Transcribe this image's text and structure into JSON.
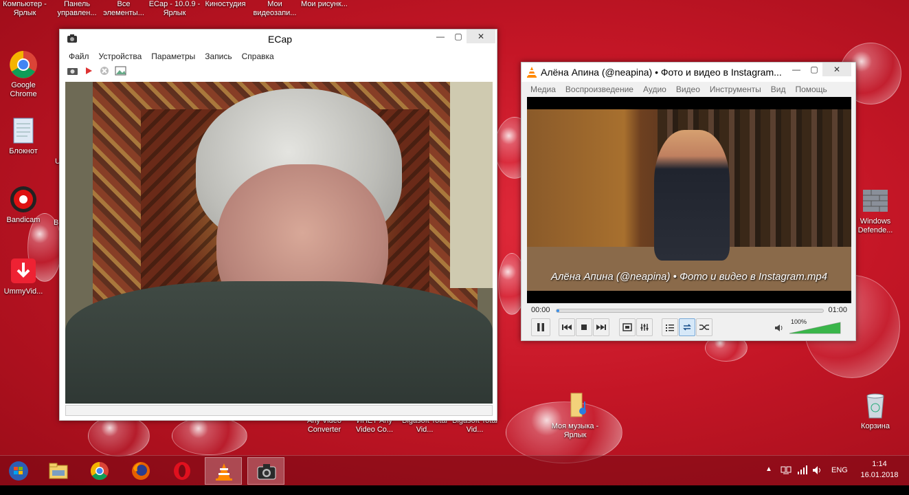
{
  "desktop": {
    "top_icons": [
      {
        "label": "Компьютер - Ярлык"
      },
      {
        "label": "Панель управлен..."
      },
      {
        "label": "Все элементы..."
      },
      {
        "label": "ECap - 10.0.9 - Ярлык"
      },
      {
        "label": "Киностудия"
      },
      {
        "label": "Мои видеозапи..."
      },
      {
        "label": "Мои рисунк..."
      }
    ],
    "left_icons": [
      {
        "label": "Google Chrome"
      },
      {
        "label": "Блокнот"
      },
      {
        "label": "Bandicam"
      },
      {
        "label": "UmmyVid..."
      }
    ],
    "left_partial": [
      "U",
      "B"
    ],
    "bottom_icons": [
      {
        "label": "Any Video Converter"
      },
      {
        "label": "ИНЕТ Any Video Co..."
      },
      {
        "label": "Bigasoft Total Vid..."
      },
      {
        "label": "Bigasoft Total Vid..."
      },
      {
        "label": "Моя музыка - Ярлык"
      }
    ],
    "right_icons": [
      {
        "label": "Windows Defende..."
      },
      {
        "label": "Корзина"
      }
    ]
  },
  "ecap": {
    "title": "ECap",
    "menu": [
      "Файл",
      "Устройства",
      "Параметры",
      "Запись",
      "Справка"
    ],
    "toolbar": [
      "camera-icon",
      "record-icon",
      "stop-icon",
      "image-icon"
    ]
  },
  "vlc": {
    "title": "Алёна Апина (@neapina) • Фото и видео в Instagram...",
    "menu": [
      "Медиа",
      "Воспроизведение",
      "Аудио",
      "Видео",
      "Инструменты",
      "Вид",
      "Помощь"
    ],
    "subtitle": "Алёна Апина (@neapina) • Фото и видео в Instagram.mp4",
    "time_current": "00:00",
    "time_total": "01:00",
    "progress": 0.01,
    "volume_label": "100%",
    "volume": 1.0
  },
  "taskbar": {
    "apps": [
      "start-button",
      "file-explorer",
      "chrome",
      "firefox",
      "opera",
      "vlc",
      "ecap"
    ],
    "tray": {
      "lang": "ENG",
      "time": "1:14",
      "date": "16.01.2018"
    }
  },
  "colors": {
    "desktop": "#c41626",
    "taskbar": "#7a0a14",
    "vlc_orange": "#ff8800",
    "volume_green": "#3ab54a"
  }
}
